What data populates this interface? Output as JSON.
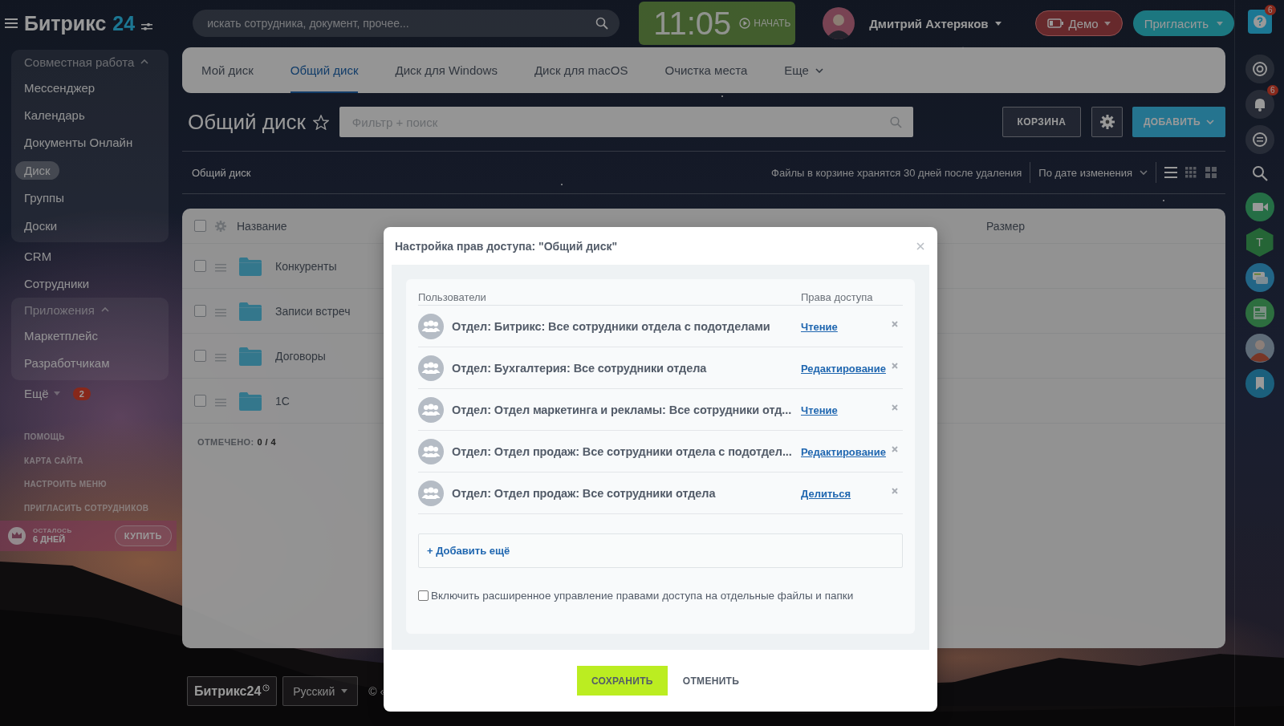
{
  "header": {
    "logo": {
      "name": "Битрикс",
      "number": "24"
    },
    "search": {
      "placeholder": "искать сотрудника, документ, прочее..."
    },
    "timer": {
      "time": "11:05",
      "action": "НАЧАТЬ"
    },
    "user": {
      "name": "Дмитрий Ахтеряков"
    },
    "demo_button": "Демо",
    "invite_button": "Пригласить"
  },
  "sidebar": {
    "items": [
      {
        "kind": "group",
        "title": "Совместная работа",
        "expanded": true,
        "children": [
          {
            "label": "Мессенджер",
            "selected": false
          },
          {
            "label": "Календарь",
            "selected": false
          },
          {
            "label": "Документы Онлайн",
            "selected": false
          },
          {
            "label": "Диск",
            "selected": true
          },
          {
            "label": "Группы",
            "selected": false
          },
          {
            "label": "Доски",
            "selected": false
          }
        ]
      },
      {
        "kind": "item",
        "label": "CRM",
        "selected": false
      },
      {
        "kind": "item",
        "label": "Сотрудники",
        "selected": false
      },
      {
        "kind": "group",
        "title": "Приложения",
        "expanded": true,
        "children": [
          {
            "label": "Маркетплейс",
            "selected": false
          },
          {
            "label": "Разработчикам",
            "selected": false
          }
        ]
      },
      {
        "kind": "more",
        "label": "Ещё",
        "badge": "2"
      }
    ],
    "links": [
      "ПОМОЩЬ",
      "КАРТА САЙТА",
      "НАСТРОИТЬ МЕНЮ",
      "ПРИГЛАСИТЬ СОТРУДНИКОВ"
    ],
    "trial": {
      "caption": "ОСТАЛОСЬ",
      "days": "6 ДНЕЙ",
      "button": "КУПИТЬ"
    }
  },
  "main": {
    "tabs": [
      {
        "label": "Мой диск",
        "selected": false
      },
      {
        "label": "Общий диск",
        "selected": true
      },
      {
        "label": "Диск для Windows",
        "selected": false
      },
      {
        "label": "Диск для macOS",
        "selected": false
      },
      {
        "label": "Очистка места",
        "selected": false
      }
    ],
    "more_tab": "Еще",
    "title": "Общий диск",
    "favorite": false,
    "filter": {
      "placeholder": "Фильтр + поиск"
    },
    "trash_button": "КОРЗИНА",
    "add_button": "ДОБАВИТЬ",
    "breadcrumb": "Общий диск",
    "trash_note": "Файлы в корзине хранятся 30 дней после удаления",
    "sort": "По дате изменения",
    "view_modes": [
      {
        "kind": "list",
        "selected": true
      },
      {
        "kind": "tiles",
        "selected": false
      },
      {
        "kind": "large-tiles",
        "selected": false
      }
    ],
    "table": {
      "all_checked": false,
      "columns": [
        "Название",
        "Размер"
      ],
      "rows": [
        {
          "name": "Конкуренты",
          "checked": false
        },
        {
          "name": "Записи встреч",
          "checked": false
        },
        {
          "name": "Договоры",
          "checked": false
        },
        {
          "name": "1С",
          "checked": false
        }
      ],
      "marked_label": "ОТМЕЧЕНО:",
      "marked_count": "0 / 4"
    }
  },
  "footer": {
    "logo": "Битрикс24",
    "language": "Русский",
    "copyright": "© «"
  },
  "rightbar": {
    "help_badge": "6",
    "notifications_badge": "6",
    "hexagon_letter": "T"
  },
  "dialog": {
    "title": "Настройка прав доступа: \"Общий диск\"",
    "columns": [
      "Пользователи",
      "Права доступа"
    ],
    "entries": [
      {
        "name": "Отдел: Битрикс: Все сотрудники отдела с подотделами",
        "access": "Чтение"
      },
      {
        "name": "Отдел: Бухгалтерия: Все сотрудники отдела",
        "access": "Редактирование"
      },
      {
        "name": "Отдел: Отдел маркетинга и рекламы: Все сотрудники отд...",
        "access": "Чтение"
      },
      {
        "name": "Отдел: Отдел продаж: Все сотрудники отдела с подотдел...",
        "access": "Редактирование"
      },
      {
        "name": "Отдел: Отдел продаж: Все сотрудники отдела",
        "access": "Делиться"
      }
    ],
    "add_link": "+ Добавить ещё",
    "advanced": {
      "label": "Включить расширенное управление правами доступа на отдельные файлы и папки",
      "checked": false
    },
    "save_button": "СОХРАНИТЬ",
    "cancel_button": "ОТМЕНИТЬ"
  }
}
